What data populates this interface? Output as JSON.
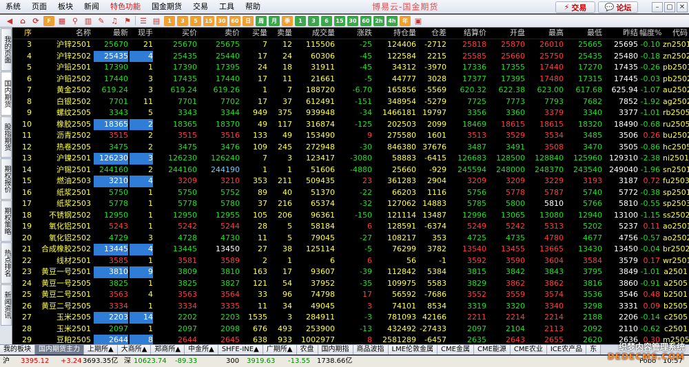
{
  "menu": [
    "系统",
    "页面",
    "板块",
    "新闻",
    "特色功能",
    "国金期货",
    "交易",
    "工具",
    "帮助"
  ],
  "title": "博易云-国金期货",
  "buttons": {
    "trade": "交易",
    "forum": "论坛"
  },
  "toolbar_labels": [
    "1",
    "3",
    "5",
    "15",
    "30",
    "60",
    "日",
    "周",
    "月",
    "季",
    "1",
    "3",
    "6",
    "15",
    "30",
    "60",
    "2h",
    "4h",
    "年"
  ],
  "left_tabs": [
    "我的页面",
    "国内期货",
    "股指期货",
    "期权报价",
    "期权策略",
    "热点排名",
    "新闻资讯"
  ],
  "columns": [
    "序",
    "名称",
    "最新",
    "现手",
    "买价",
    "卖价",
    "买量",
    "卖量",
    "成交量",
    "涨跌",
    "持仓量",
    "仓差",
    "结算价",
    "开盘",
    "最高",
    "最低",
    "昨结",
    "幅度%",
    "代码"
  ],
  "rows": [
    {
      "seq": "3",
      "name": "沪锌2501",
      "last": "25670",
      "cur": "21",
      "bid": "25670",
      "ask": "25675",
      "bidv": "7",
      "askv": "12",
      "vol": "115506",
      "chg": "-25",
      "oi": "124406",
      "oid": "-2712",
      "settle": "25818",
      "open": "25870",
      "high": "26010",
      "low": "25665",
      "pre": "25695",
      "pct": "-0.10",
      "code": "zn2501"
    },
    {
      "seq": "4",
      "name": "沪锌2502",
      "last": "25435",
      "cur": "4",
      "bid": "25435",
      "ask": "25440",
      "bidv": "17",
      "askv": "24",
      "vol": "60306",
      "chg": "-45",
      "oi": "122584",
      "oid": "2215",
      "settle": "25585",
      "open": "25660",
      "high": "25750",
      "low": "25435",
      "pre": "25480",
      "pct": "-0.18",
      "code": "zn2502"
    },
    {
      "seq": "5",
      "name": "沪铅2501",
      "last": "17390",
      "cur": "1",
      "bid": "17390",
      "ask": "17395",
      "bidv": "24",
      "askv": "18",
      "vol": "31911",
      "chg": "-45",
      "oi": "34312",
      "oid": "-3970",
      "settle": "17336",
      "open": "17355",
      "high": "17440",
      "low": "17270",
      "pre": "17435",
      "pct": "-0.26",
      "code": "pb2501"
    },
    {
      "seq": "6",
      "name": "沪铅2502",
      "last": "17440",
      "cur": "3",
      "bid": "17435",
      "ask": "17440",
      "bidv": "17",
      "askv": "11",
      "vol": "21661",
      "chg": "-5",
      "oi": "44777",
      "oid": "3028",
      "settle": "17377",
      "open": "17395",
      "high": "17480",
      "low": "17315",
      "pre": "17445",
      "pct": "-0.03",
      "code": "pb2502"
    },
    {
      "seq": "7",
      "name": "黄金2502",
      "last": "619.24",
      "cur": "3",
      "bid": "619.24",
      "ask": "619.26",
      "bidv": "1",
      "askv": "7",
      "vol": "188720",
      "chg": "-6.70",
      "oi": "165856",
      "oid": "-5569",
      "settle": "620.32",
      "open": "622.38",
      "high": "623.00",
      "low": "617.68",
      "pre": "625.94",
      "pct": "-1.07",
      "code": "au2502"
    },
    {
      "seq": "8",
      "name": "白银2502",
      "last": "7701",
      "cur": "11",
      "bid": "7701",
      "ask": "7702",
      "bidv": "17",
      "askv": "37",
      "vol": "612491",
      "chg": "-151",
      "oi": "348954",
      "oid": "-5279",
      "settle": "7725",
      "open": "7773",
      "high": "7793",
      "low": "7682",
      "pre": "7852",
      "pct": "-1.92",
      "code": "ag2502"
    },
    {
      "seq": "9",
      "name": "螺纹2505",
      "last": "3343",
      "cur": "5",
      "bid": "3343",
      "ask": "3344",
      "bidv": "949",
      "askv": "375",
      "vol": "939948",
      "chg": "-34",
      "oi": "1466181",
      "oid": "19797",
      "settle": "3356",
      "open": "3360",
      "high": "3379",
      "low": "3340",
      "pre": "3377",
      "pct": "-1.01",
      "code": "rb2505"
    },
    {
      "seq": "10",
      "name": "橡胶2505",
      "last": "18365",
      "cur": "2",
      "bid": "18365",
      "ask": "18370",
      "bidv": "49",
      "askv": "117",
      "vol": "316874",
      "chg": "-125",
      "oi": "202503",
      "oid": "2099",
      "settle": "18469",
      "open": "18615",
      "high": "18615",
      "low": "18320",
      "pre": "18490",
      "pct": "-0.68",
      "code": "ru2505"
    },
    {
      "seq": "11",
      "name": "沥青2502",
      "last": "3515",
      "cur": "2",
      "bid": "3515",
      "ask": "3516",
      "bidv": "133",
      "askv": "49",
      "vol": "153490",
      "chg": "9",
      "oi": "275580",
      "oid": "1601",
      "settle": "3513",
      "open": "3529",
      "high": "3534",
      "low": "3485",
      "pre": "3506",
      "pct": "0.26",
      "code": "bu2502"
    },
    {
      "seq": "12",
      "name": "热卷2505",
      "last": "3475",
      "cur": "2",
      "bid": "3475",
      "ask": "3476",
      "bidv": "109",
      "askv": "245",
      "vol": "272948",
      "chg": "-30",
      "oi": "846380",
      "oid": "37676",
      "settle": "3487",
      "open": "3491",
      "high": "3508",
      "low": "3470",
      "pre": "3505",
      "pct": "-0.86",
      "code": "hc2505"
    },
    {
      "seq": "13",
      "name": "沪镍2501",
      "last": "126230",
      "cur": "3",
      "bid": "126230",
      "ask": "126240",
      "bidv": "7",
      "askv": "3",
      "vol": "123417",
      "chg": "-3080",
      "oi": "58883",
      "oid": "-6415",
      "settle": "126683",
      "open": "128500",
      "high": "128840",
      "low": "125960",
      "pre": "129310",
      "pct": "-2.38",
      "code": "ni2501"
    },
    {
      "seq": "14",
      "name": "沪锡2501",
      "last": "244160",
      "cur": "2",
      "bid": "244160",
      "ask": "244190",
      "bidv": "1",
      "askv": "1",
      "vol": "51606",
      "chg": "-4880",
      "oi": "25660",
      "oid": "-929",
      "settle": "245594",
      "open": "248000",
      "high": "248370",
      "low": "243540",
      "pre": "249040",
      "pct": "-1.96",
      "code": "sn2501"
    },
    {
      "seq": "15",
      "name": "燃油2503",
      "last": "3210",
      "cur": "4",
      "bid": "3209",
      "ask": "3210",
      "bidv": "353",
      "askv": "211",
      "vol": "509435",
      "chg": "23",
      "oi": "361283",
      "oid": "2904",
      "settle": "3209",
      "open": "3209",
      "high": "3229",
      "low": "3193",
      "pre": "3187",
      "pct": "0.72",
      "code": "fu2503"
    },
    {
      "seq": "16",
      "name": "纸浆2501",
      "last": "5750",
      "cur": "1",
      "bid": "5750",
      "ask": "5752",
      "bidv": "89",
      "askv": "40",
      "vol": "51370",
      "chg": "-22",
      "oi": "66203",
      "oid": "1116",
      "settle": "5756",
      "open": "5778",
      "high": "5787",
      "low": "5740",
      "pre": "5772",
      "pct": "-0.38",
      "code": "sp2501"
    },
    {
      "seq": "17",
      "name": "纸浆2503",
      "last": "5778",
      "cur": "1",
      "bid": "5778",
      "ask": "5780",
      "bidv": "37",
      "askv": "216",
      "vol": "65374",
      "chg": "-32",
      "oi": "127062",
      "oid": "14883",
      "settle": "5785",
      "open": "5800",
      "high": "5810",
      "low": "5766",
      "pre": "5810",
      "pct": "-0.55",
      "code": "sp2503"
    },
    {
      "seq": "18",
      "name": "不锈钢2502",
      "last": "12950",
      "cur": "1",
      "bid": "12950",
      "ask": "12955",
      "bidv": "105",
      "askv": "206",
      "vol": "96361",
      "chg": "-150",
      "oi": "121114",
      "oid": "13487",
      "settle": "12996",
      "open": "13065",
      "high": "13080",
      "low": "12940",
      "pre": "13100",
      "pct": "-1.15",
      "code": "ss2502"
    },
    {
      "seq": "19",
      "name": "氧化铝2501",
      "last": "5243",
      "cur": "1",
      "bid": "5242",
      "ask": "5244",
      "bidv": "28",
      "askv": "5",
      "vol": "58184",
      "chg": "6",
      "oi": "128591",
      "oid": "-6374",
      "settle": "5249",
      "open": "5242",
      "high": "5313",
      "low": "5202",
      "pre": "5237",
      "pct": "0.11",
      "code": "ao2501"
    },
    {
      "seq": "20",
      "name": "氧化铝2502",
      "last": "4729",
      "cur": "3",
      "bid": "4728",
      "ask": "4730",
      "bidv": "11",
      "askv": "5",
      "vol": "79045",
      "chg": "-27",
      "oi": "108217",
      "oid": "353",
      "settle": "4725",
      "open": "4735",
      "high": "4780",
      "low": "4677",
      "pre": "4756",
      "pct": "-0.57",
      "code": "ao2502"
    },
    {
      "seq": "21",
      "name": "合成橡胶2502",
      "last": "13445",
      "cur": "4",
      "bid": "13445",
      "ask": "13450",
      "bidv": "27",
      "askv": "38",
      "vol": "125114",
      "chg": "-5",
      "oi": "76299",
      "oid": "3782",
      "settle": "13540",
      "open": "13455",
      "high": "13665",
      "low": "13430",
      "pre": "13450",
      "pct": "-0.04",
      "code": "br2502"
    },
    {
      "seq": "22",
      "name": "线材2501",
      "last": "3585",
      "cur": "1",
      "bid": "3581",
      "ask": "3589",
      "bidv": "2",
      "askv": "1",
      "vol": "6",
      "chg": "6",
      "oi": "56",
      "oid": "-1",
      "settle": "3592",
      "open": "3590",
      "high": "3604",
      "low": "3584",
      "pre": "3579",
      "pct": "0.17",
      "code": "wr2501"
    },
    {
      "seq": "23",
      "name": "黄豆一号2501",
      "last": "3810",
      "cur": "9",
      "bid": "3809",
      "ask": "3810",
      "bidv": "163",
      "askv": "17",
      "vol": "93607",
      "chg": "-39",
      "oi": "112842",
      "oid": "5384",
      "settle": "3815",
      "open": "3842",
      "high": "3843",
      "low": "3795",
      "pre": "3849",
      "pct": "-1.01",
      "code": "a2501"
    },
    {
      "seq": "24",
      "name": "黄豆一号2505",
      "last": "3825",
      "cur": "1",
      "bid": "3825",
      "ask": "3827",
      "bidv": "121",
      "askv": "54",
      "vol": "37952",
      "chg": "-35",
      "oi": "109975",
      "oid": "5583",
      "settle": "3829",
      "open": "3862",
      "high": "3862",
      "low": "3816",
      "pre": "3860",
      "pct": "-0.91",
      "code": "a2505"
    },
    {
      "seq": "25",
      "name": "黄豆二号2501",
      "last": "3563",
      "cur": "4",
      "bid": "3563",
      "ask": "3564",
      "bidv": "33",
      "askv": "96",
      "vol": "74798",
      "chg": "17",
      "oi": "56592",
      "oid": "-7686",
      "settle": "3552",
      "open": "3559",
      "high": "3574",
      "low": "3536",
      "pre": "3546",
      "pct": "0.48",
      "code": "b2501"
    },
    {
      "seq": "26",
      "name": "黄豆二号2505",
      "last": "3334",
      "cur": "1",
      "bid": "3334",
      "ask": "3335",
      "bidv": "11",
      "askv": "34",
      "vol": "49045",
      "chg": "3",
      "oi": "74101",
      "oid": "8534",
      "settle": "3319",
      "open": "3320",
      "high": "3340",
      "low": "3298",
      "pre": "3331",
      "pct": "0.09",
      "code": "b2505"
    },
    {
      "seq": "27",
      "name": "玉米2505",
      "last": "2203",
      "cur": "14",
      "bid": "2202",
      "ask": "2203",
      "bidv": "1535",
      "askv": "3",
      "vol": "284911",
      "chg": "-3",
      "oi": "781093",
      "oid": "42166",
      "settle": "2211",
      "open": "2214",
      "high": "2214",
      "low": "2188",
      "pre": "2206",
      "pct": "-0.14",
      "code": "c2505"
    },
    {
      "seq": "28",
      "name": "玉米2501",
      "last": "2097",
      "cur": "1",
      "bid": "2097",
      "ask": "2098",
      "bidv": "676",
      "askv": "493",
      "vol": "253900",
      "chg": "-13",
      "oi": "432492",
      "oid": "-27433",
      "settle": "2097",
      "open": "2104",
      "high": "2113",
      "low": "2092",
      "pre": "2110",
      "pct": "-0.62",
      "code": "c2501"
    },
    {
      "seq": "29",
      "name": "豆粕2505",
      "last": "2644",
      "cur": "8",
      "bid": "2644",
      "ask": "2645",
      "bidv": "638",
      "askv": "933",
      "vol": "1002977",
      "chg": "8",
      "oi": "2581289",
      "oid": "-6457",
      "settle": "2635",
      "open": "2643",
      "high": "2655",
      "low": "2620",
      "pre": "2636",
      "pct": "0.30",
      "code": "m2505"
    }
  ],
  "bottom_tabs": [
    "我的板块",
    "国内期货主力",
    "上期所▲",
    "大商所▲",
    "郑商所▲",
    "中金所▲",
    "SHFE-INE▲",
    "广期所▲",
    "农盘",
    "国内期指",
    "商品波指",
    "LME伦敦金属",
    "CME金属",
    "CME能源",
    "CME农业",
    "ICE农产品",
    "东"
  ],
  "status": {
    "sh_label": "沪",
    "sh_index": "3395.12",
    "sh_change": "+3.24",
    "sh_amount": "3693.35亿",
    "sz_label": "深",
    "sz_index": "10623.74",
    "sz_change": "-89.33",
    "cyb_label": "300",
    "cyb_index": "3919.63",
    "cyb_change": "-13.55",
    "cyb_amount": "1738.66亿",
    "net": "Pobo",
    "time": "10:57"
  },
  "watermark": {
    "line1": "织梦内容管理系统",
    "line2": "DEDECMS.COM"
  },
  "colors": {
    "up": "#ff3c3c",
    "down": "#1fe01f",
    "flat": "#ffffff",
    "highlight": "#2f7dd6"
  }
}
